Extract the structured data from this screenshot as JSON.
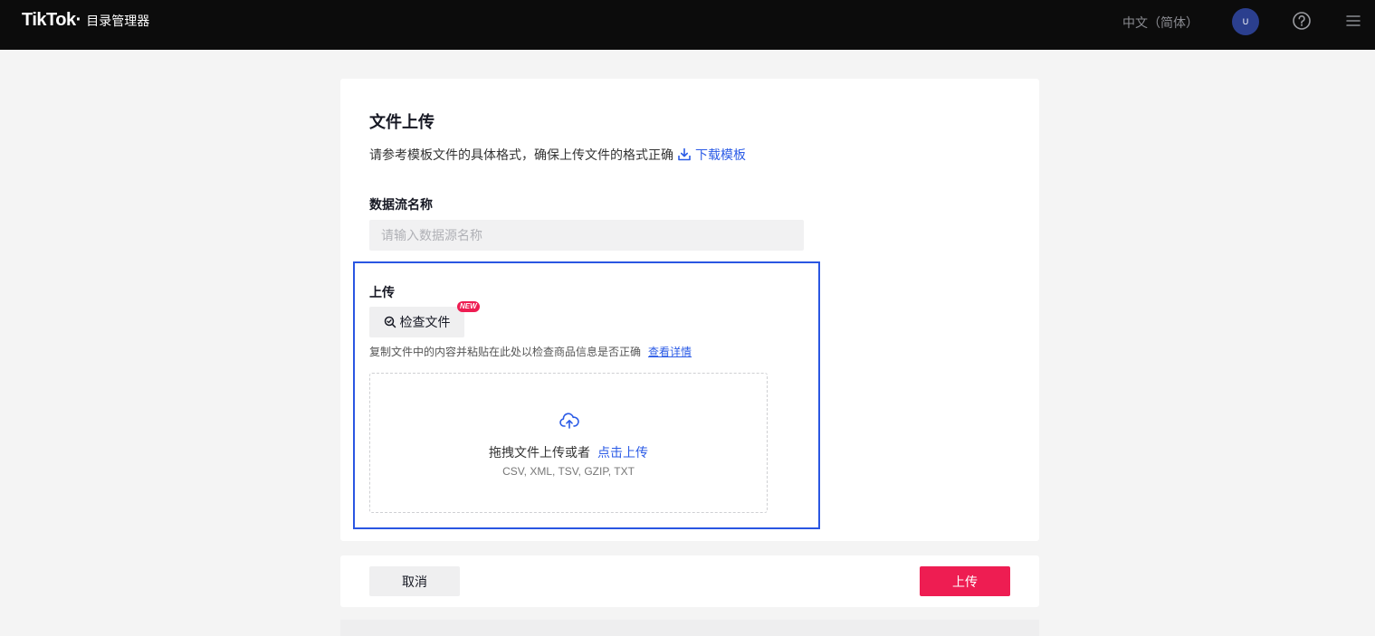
{
  "header": {
    "logo": "TikTok",
    "logo_dot": "·",
    "app_name": "目录管理器",
    "language": "中文（简体）",
    "avatar_initial": "U",
    "help_icon": "question-circle-icon",
    "menu_icon": "hamburger-menu-icon"
  },
  "form": {
    "title": "文件上传",
    "description": "请参考模板文件的具体格式，确保上传文件的格式正确",
    "download_link": "下载模板",
    "stream_name_label": "数据流名称",
    "stream_name_placeholder": "请输入数据源名称",
    "stream_name_value": ""
  },
  "upload": {
    "label": "上传",
    "check_file_button": "检查文件",
    "new_badge": "NEW",
    "hint": "复制文件中的内容并粘贴在此处以检查商品信息是否正确",
    "hint_link": "查看详情",
    "drop_text": "拖拽文件上传或者",
    "drop_link": "点击上传",
    "formats": "CSV, XML, TSV, GZIP, TXT"
  },
  "footer": {
    "cancel": "取消",
    "submit": "上传"
  },
  "colors": {
    "accent_blue": "#2b5be6",
    "brand_red": "#ee1d52",
    "highlight_border": "#2a56e2"
  }
}
